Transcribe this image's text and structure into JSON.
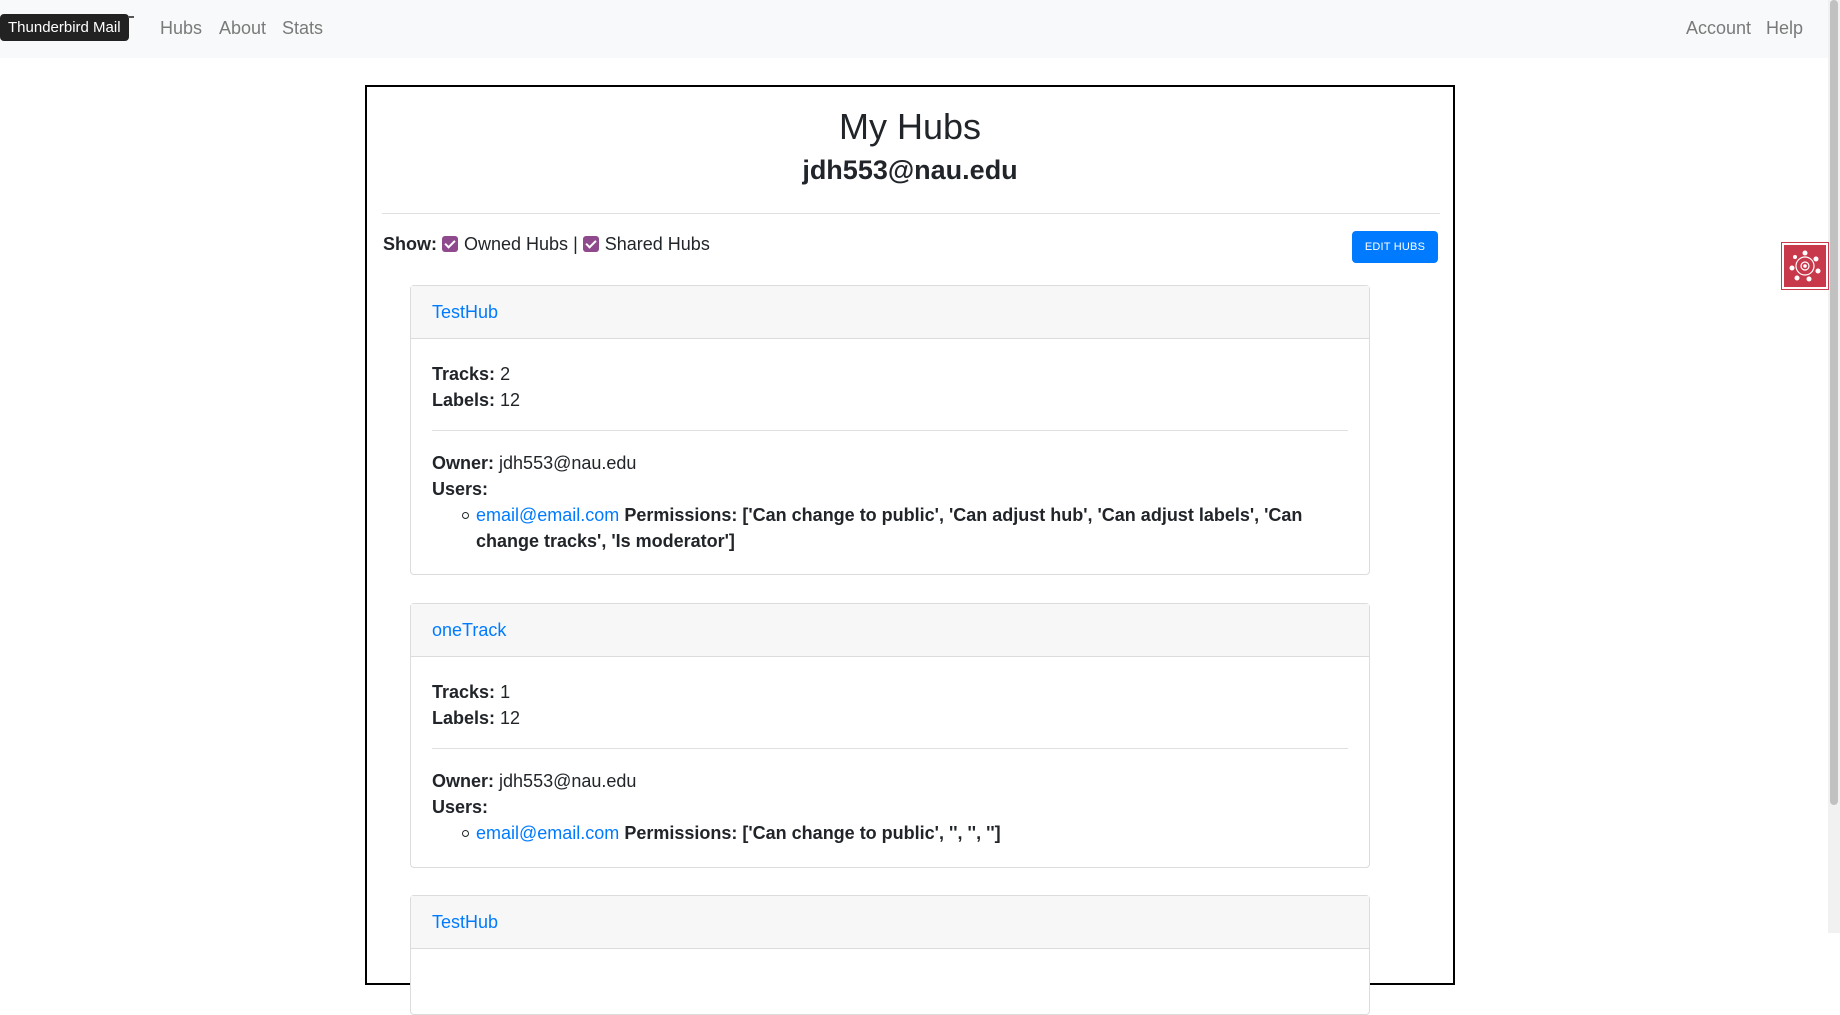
{
  "tooltip": "Thunderbird Mail",
  "nav": {
    "left": [
      "Hubs",
      "About",
      "Stats"
    ],
    "right": [
      "Account",
      "Help"
    ]
  },
  "page": {
    "title": "My Hubs",
    "subtitle": "jdh553@nau.edu"
  },
  "filters": {
    "show_label": "Show:",
    "owned_label": "Owned Hubs",
    "owned_checked": true,
    "separator": "|",
    "shared_label": "Shared Hubs",
    "shared_checked": true
  },
  "edit_button": "EDIT HUBS",
  "labels": {
    "tracks": "Tracks:",
    "labels": "Labels:",
    "owner": "Owner:",
    "users": "Users:",
    "permissions": "Permissions:"
  },
  "hubs": [
    {
      "name": "TestHub",
      "tracks": "2",
      "labels": "12",
      "owner": "jdh553@nau.edu",
      "users": [
        {
          "email": "email@email.com",
          "permissions": "['Can change to public', 'Can adjust hub', 'Can adjust labels', 'Can change tracks', 'Is moderator']"
        }
      ]
    },
    {
      "name": "oneTrack",
      "tracks": "1",
      "labels": "12",
      "owner": "jdh553@nau.edu",
      "users": [
        {
          "email": "email@email.com",
          "permissions": "['Can change to public', '', '', '']"
        }
      ]
    },
    {
      "name": "TestHub"
    }
  ],
  "colors": {
    "accent": "#007bff",
    "checkbox": "#8e4a8c",
    "widget": "#c9394c",
    "navbar_bg": "#f8f9fa"
  }
}
